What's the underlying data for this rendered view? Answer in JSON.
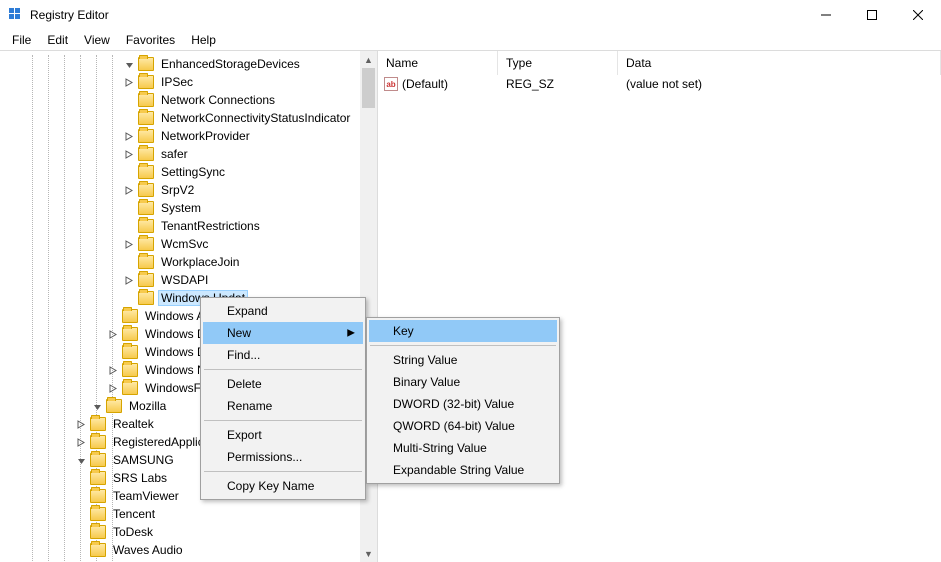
{
  "window": {
    "title": "Registry Editor"
  },
  "menus": {
    "file": "File",
    "edit": "Edit",
    "view": "View",
    "favorites": "Favorites",
    "help": "Help"
  },
  "tree": {
    "items": [
      {
        "indent": 120,
        "expand": "open",
        "label": "EnhancedStorageDevices"
      },
      {
        "indent": 120,
        "expand": "closed",
        "label": "IPSec"
      },
      {
        "indent": 120,
        "expand": "none",
        "label": "Network Connections"
      },
      {
        "indent": 120,
        "expand": "none",
        "label": "NetworkConnectivityStatusIndicator"
      },
      {
        "indent": 120,
        "expand": "closed",
        "label": "NetworkProvider"
      },
      {
        "indent": 120,
        "expand": "closed",
        "label": "safer"
      },
      {
        "indent": 120,
        "expand": "none",
        "label": "SettingSync"
      },
      {
        "indent": 120,
        "expand": "closed",
        "label": "SrpV2"
      },
      {
        "indent": 120,
        "expand": "none",
        "label": "System"
      },
      {
        "indent": 120,
        "expand": "none",
        "label": "TenantRestrictions"
      },
      {
        "indent": 120,
        "expand": "closed",
        "label": "WcmSvc"
      },
      {
        "indent": 120,
        "expand": "none",
        "label": "WorkplaceJoin"
      },
      {
        "indent": 120,
        "expand": "closed",
        "label": "WSDAPI"
      },
      {
        "indent": 120,
        "expand": "none",
        "label": "Windows Update",
        "selected": true,
        "truncated": "Windows Updat"
      },
      {
        "indent": 104,
        "expand": "none",
        "label": "Windows Advanced Threat Protection",
        "truncated": "Windows Ac"
      },
      {
        "indent": 104,
        "expand": "closed",
        "label": "Windows Defender",
        "truncated": "Windows De"
      },
      {
        "indent": 104,
        "expand": "none",
        "label": "Windows Defender Security Center",
        "truncated": "Windows De"
      },
      {
        "indent": 104,
        "expand": "closed",
        "label": "Windows NT",
        "truncated": "Windows NT"
      },
      {
        "indent": 104,
        "expand": "closed",
        "label": "WindowsFirewall",
        "truncated": "WindowsFire"
      },
      {
        "indent": 88,
        "expand": "open",
        "label": "Mozilla"
      },
      {
        "indent": 72,
        "expand": "closed",
        "label": "Realtek"
      },
      {
        "indent": 72,
        "expand": "closed",
        "label": "RegisteredApplications",
        "truncated": "RegisteredApplicati"
      },
      {
        "indent": 72,
        "expand": "open",
        "label": "SAMSUNG"
      },
      {
        "indent": 72,
        "expand": "none",
        "label": "SRS Labs"
      },
      {
        "indent": 72,
        "expand": "none",
        "label": "TeamViewer"
      },
      {
        "indent": 72,
        "expand": "none",
        "label": "Tencent"
      },
      {
        "indent": 72,
        "expand": "none",
        "label": "ToDesk"
      },
      {
        "indent": 72,
        "expand": "none",
        "label": "Waves Audio"
      }
    ]
  },
  "list": {
    "headers": {
      "name": "Name",
      "type": "Type",
      "data": "Data"
    },
    "rows": [
      {
        "name": "(Default)",
        "type": "REG_SZ",
        "data": "(value not set)"
      }
    ]
  },
  "context_menu": {
    "items": {
      "expand": "Expand",
      "new": "New",
      "find": "Find...",
      "delete": "Delete",
      "rename": "Rename",
      "export": "Export",
      "permissions": "Permissions...",
      "copy_key_name": "Copy Key Name"
    }
  },
  "new_submenu": {
    "items": {
      "key": "Key",
      "string": "String Value",
      "binary": "Binary Value",
      "dword": "DWORD (32-bit) Value",
      "qword": "QWORD (64-bit) Value",
      "multi_string": "Multi-String Value",
      "expandable_string": "Expandable String Value"
    }
  }
}
